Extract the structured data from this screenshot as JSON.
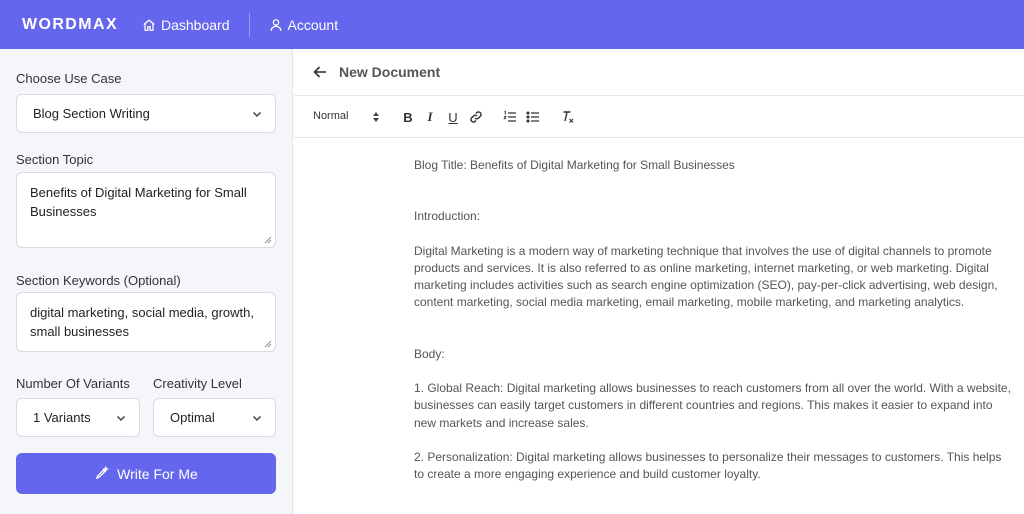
{
  "app": {
    "brand": "WORDMAX"
  },
  "nav": {
    "dashboard": "Dashboard",
    "account": "Account"
  },
  "form": {
    "use_case_label": "Choose Use Case",
    "use_case_value": "Blog Section Writing",
    "topic_label": "Section Topic",
    "topic_value": "Benefits of Digital Marketing for Small Businesses",
    "keywords_label": "Section Keywords (Optional)",
    "keywords_value": "digital marketing, social media, growth, small businesses",
    "variants_label": "Number Of Variants",
    "variants_value": "1 Variants",
    "creativity_label": "Creativity Level",
    "creativity_value": "Optimal",
    "submit_label": "Write For Me"
  },
  "document": {
    "title": "New Document",
    "toolbar": {
      "format": "Normal",
      "bold": "B",
      "italic": "I",
      "underline": "U"
    },
    "content": {
      "blog_title": "Blog Title: Benefits of Digital Marketing for Small Businesses",
      "intro_heading": "Introduction:",
      "intro_text": "Digital Marketing is a modern way of marketing technique that involves the use of digital channels to promote products and services. It is also referred to as online marketing, internet marketing, or web marketing. Digital marketing includes activities such as search engine optimization (SEO), pay-per-click advertising, web design, content marketing, social media marketing, email marketing, mobile marketing, and marketing analytics.",
      "body_heading": "Body:",
      "point_1": "1. Global Reach: Digital marketing allows businesses to reach customers from all over the world. With a website, businesses can easily target customers in different countries and regions. This makes it easier to expand into new markets and increase sales.",
      "point_2": "2. Personalization: Digital marketing allows businesses to personalize their messages to customers. This helps to create a more engaging experience and build customer loyalty."
    }
  },
  "colors": {
    "accent": "#6466ee",
    "sidebar_bg": "#f5f6fa"
  }
}
